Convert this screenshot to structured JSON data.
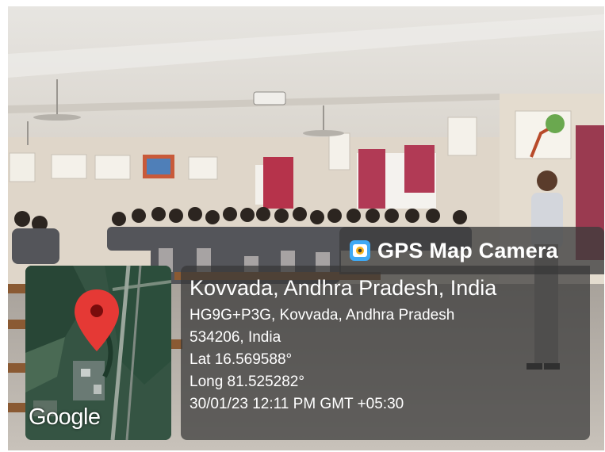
{
  "watermark": {
    "app_name": "GPS Map Camera",
    "icon": "gps-map-camera-icon",
    "map_provider": "Google"
  },
  "location": {
    "title": "Kovvada, Andhra Pradesh, India",
    "address_line1": "HG9G+P3G, Kovvada, Andhra Pradesh",
    "address_line2": "534206, India",
    "latitude": "Lat 16.569588°",
    "longitude": "Long 81.525282°",
    "timestamp": "30/01/23 12:11 PM GMT +05:30"
  },
  "colors": {
    "overlay_bg": "#373737",
    "pin": "#e53935"
  }
}
